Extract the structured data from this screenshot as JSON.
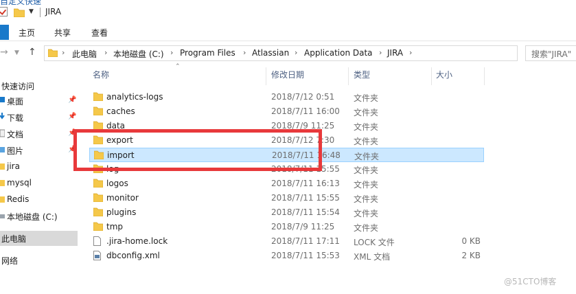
{
  "window": {
    "title": "JIRA",
    "cut_top_text": "自定义快速"
  },
  "ribbon": {
    "tabs": [
      "主页",
      "共享",
      "查看"
    ]
  },
  "address": {
    "segments": [
      "此电脑",
      "本地磁盘 (C:)",
      "Program Files",
      "Atlassian",
      "Application Data",
      "JIRA"
    ],
    "search_placeholder": "搜索\"JIRA\""
  },
  "nav": {
    "items": [
      {
        "label": "快速访问",
        "icon": "star-icon",
        "pinned": false
      },
      {
        "label": "桌面",
        "icon": "desktop-icon",
        "pinned": true
      },
      {
        "label": "下载",
        "icon": "download-icon",
        "pinned": true
      },
      {
        "label": "文档",
        "icon": "document-icon",
        "pinned": true
      },
      {
        "label": "图片",
        "icon": "picture-icon",
        "pinned": true
      },
      {
        "label": "jira",
        "icon": "folder-icon",
        "pinned": false
      },
      {
        "label": "mysql",
        "icon": "folder-icon",
        "pinned": false
      },
      {
        "label": "Redis",
        "icon": "folder-icon",
        "pinned": false
      },
      {
        "label": "本地磁盘 (C:)",
        "icon": "drive-icon",
        "pinned": false
      },
      {
        "label": "此电脑",
        "icon": "computer-icon",
        "pinned": false,
        "selected": true
      },
      {
        "label": "网络",
        "icon": "network-icon",
        "pinned": false
      }
    ]
  },
  "columns": {
    "name": "名称",
    "date": "修改日期",
    "type": "类型",
    "size": "大小"
  },
  "files": [
    {
      "name": "analytics-logs",
      "date": "2018/7/12 0:51",
      "type": "文件夹",
      "size": "",
      "icon": "folder"
    },
    {
      "name": "caches",
      "date": "2018/7/11 16:00",
      "type": "文件夹",
      "size": "",
      "icon": "folder"
    },
    {
      "name": "data",
      "date": "2018/7/9 11:25",
      "type": "文件夹",
      "size": "",
      "icon": "folder"
    },
    {
      "name": "export",
      "date": "2018/7/12 7:30",
      "type": "文件夹",
      "size": "",
      "icon": "folder"
    },
    {
      "name": "import",
      "date": "2018/7/11 16:48",
      "type": "文件夹",
      "size": "",
      "icon": "folder",
      "selected": true
    },
    {
      "name": "log",
      "date": "2018/7/11 15:55",
      "type": "文件夹",
      "size": "",
      "icon": "folder"
    },
    {
      "name": "logos",
      "date": "2018/7/11 16:13",
      "type": "文件夹",
      "size": "",
      "icon": "folder"
    },
    {
      "name": "monitor",
      "date": "2018/7/11 15:55",
      "type": "文件夹",
      "size": "",
      "icon": "folder"
    },
    {
      "name": "plugins",
      "date": "2018/7/11 15:54",
      "type": "文件夹",
      "size": "",
      "icon": "folder"
    },
    {
      "name": "tmp",
      "date": "2018/7/9 11:25",
      "type": "文件夹",
      "size": "",
      "icon": "folder"
    },
    {
      "name": ".jira-home.lock",
      "date": "2018/7/11 17:11",
      "type": "LOCK 文件",
      "size": "0 KB",
      "icon": "file"
    },
    {
      "name": "dbconfig.xml",
      "date": "2018/7/11 15:53",
      "type": "XML 文档",
      "size": "2 KB",
      "icon": "xml"
    }
  ],
  "watermark": "@51CTO博客",
  "colors": {
    "accent": "#1979ca",
    "selection": "#cce8ff",
    "highlight_box": "#e8393b",
    "folder": "#f5c84a"
  }
}
